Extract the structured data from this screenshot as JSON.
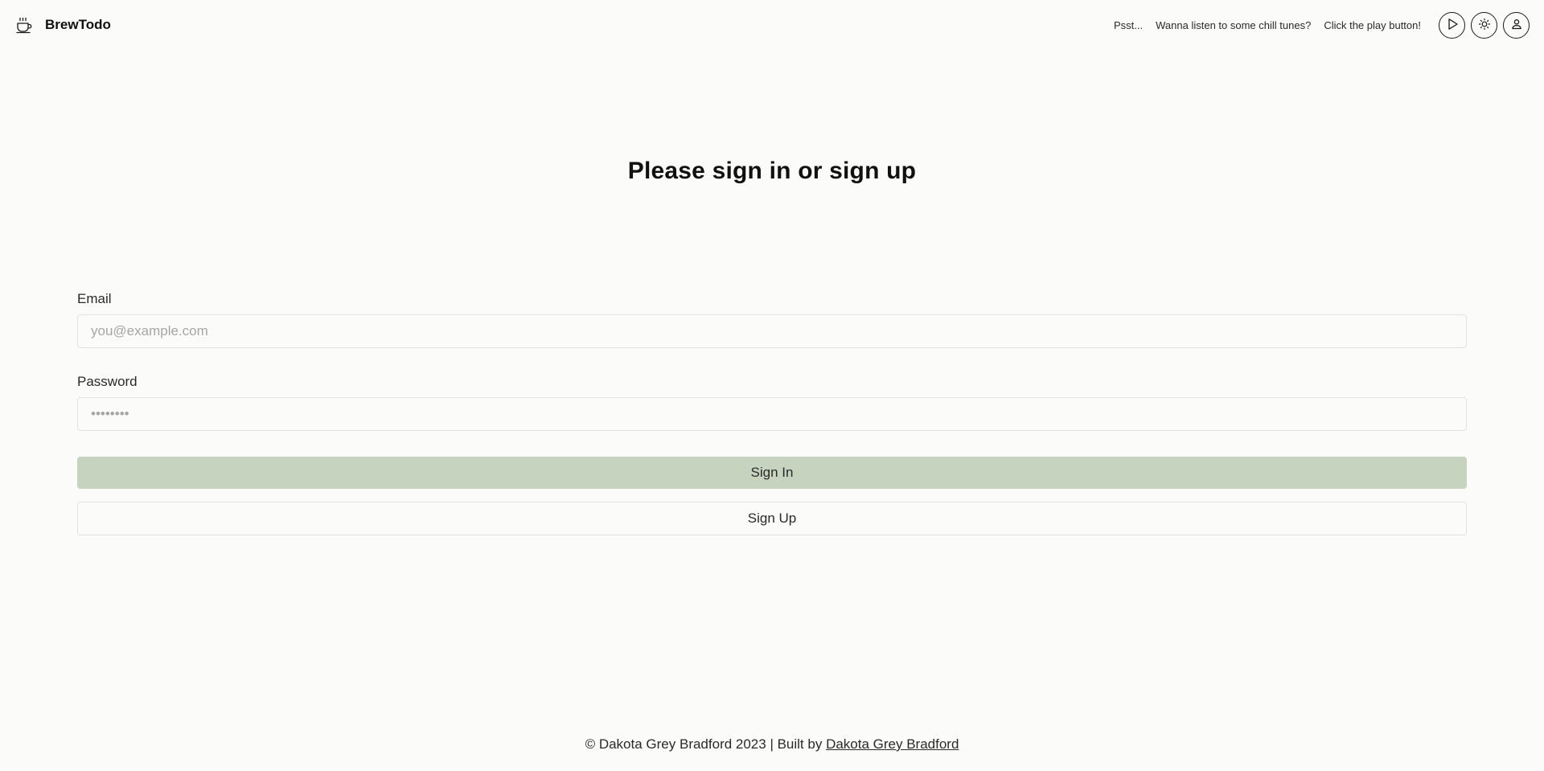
{
  "header": {
    "brand_name": "BrewTodo",
    "logo_icon": "coffee-cup-icon",
    "tune_prompt_1": "Psst...",
    "tune_prompt_2": "Wanna listen to some chill tunes?",
    "tune_prompt_3": "Click the play button!",
    "buttons": [
      {
        "icon": "play-icon"
      },
      {
        "icon": "sun-icon"
      },
      {
        "icon": "user-icon"
      }
    ]
  },
  "main": {
    "title": "Please sign in or sign up",
    "email": {
      "label": "Email",
      "placeholder": "you@example.com",
      "value": ""
    },
    "password": {
      "label": "Password",
      "placeholder": "••••••••",
      "value": ""
    },
    "sign_in_label": "Sign In",
    "sign_up_label": "Sign Up"
  },
  "footer": {
    "copyright": "© Dakota Grey Bradford 2023 | Built by ",
    "author_link": "Dakota Grey Bradford"
  },
  "colors": {
    "background": "#fbfbf9",
    "sign_in_button": "#c5d3bf",
    "border": "#e2e2df",
    "text": "#1f1f1f"
  }
}
